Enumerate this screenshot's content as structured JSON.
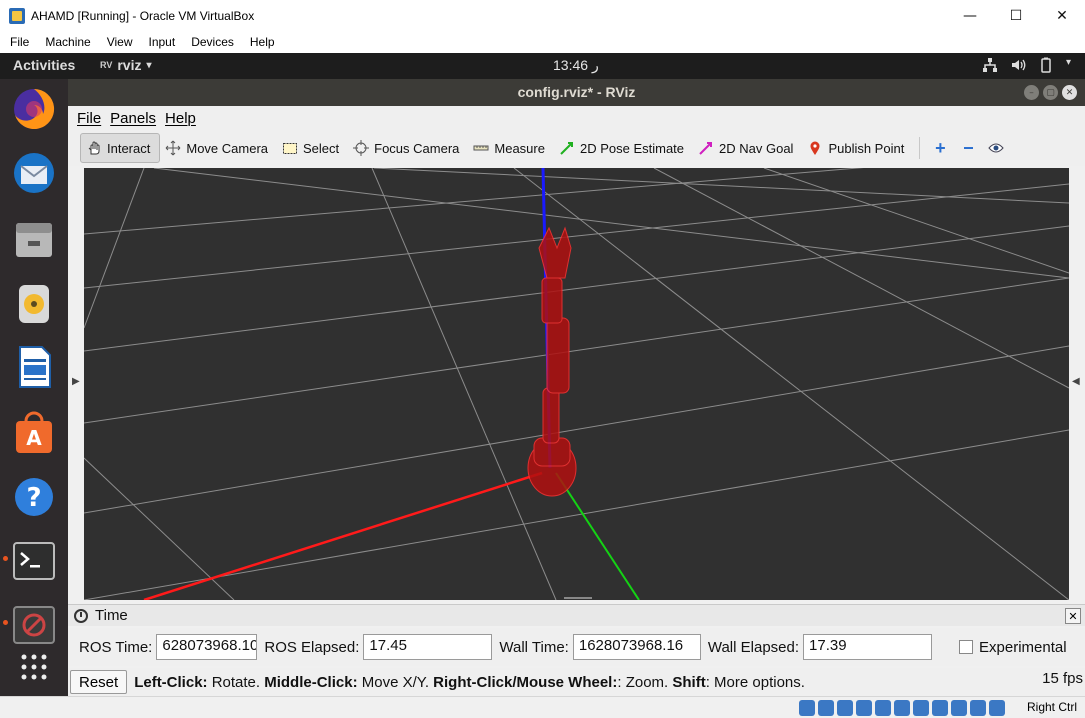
{
  "host_window": {
    "title": "AHAMD [Running] - Oracle VM VirtualBox",
    "menu": [
      "File",
      "Machine",
      "View",
      "Input",
      "Devices",
      "Help"
    ],
    "controls": [
      "—",
      "☐",
      "✕"
    ],
    "status_key": "Right Ctrl"
  },
  "gnome": {
    "activities": "Activities",
    "app_name": "rviz",
    "app_icon_text": "RV",
    "clock": "13:46 ر"
  },
  "dock": {
    "items": [
      "firefox",
      "thunderbird",
      "files",
      "rhythmbox",
      "libreoffice-writer",
      "software-center",
      "help",
      "terminal",
      "ros-app",
      "show-applications"
    ]
  },
  "rviz": {
    "window_title": "config.rviz* - RViz",
    "menu": [
      "File",
      "Panels",
      "Help"
    ],
    "tools": [
      {
        "label": "Interact",
        "icon": "hand-icon"
      },
      {
        "label": "Move Camera",
        "icon": "move-camera-icon"
      },
      {
        "label": "Select",
        "icon": "select-icon"
      },
      {
        "label": "Focus Camera",
        "icon": "focus-camera-icon"
      },
      {
        "label": "Measure",
        "icon": "ruler-icon"
      },
      {
        "label": "2D Pose Estimate",
        "icon": "green-arrow-icon"
      },
      {
        "label": "2D Nav Goal",
        "icon": "magenta-arrow-icon"
      },
      {
        "label": "Publish Point",
        "icon": "map-pin-icon"
      }
    ],
    "active_tool": "Interact",
    "colors": {
      "viewport_bg": "#303030",
      "grid": "#8c8c8c",
      "axis_x": "#ff0000",
      "axis_y": "#00ff00",
      "axis_z": "#0000ff",
      "robot": "#c81010"
    }
  },
  "time_panel": {
    "title": "Time",
    "ros_time_label": "ROS Time:",
    "ros_time_value": "628073968.10",
    "ros_elapsed_label": "ROS Elapsed:",
    "ros_elapsed_value": "17.45",
    "wall_time_label": "Wall Time:",
    "wall_time_value": "1628073968.16",
    "wall_elapsed_label": "Wall Elapsed:",
    "wall_elapsed_value": "17.39",
    "experimental_label": "Experimental"
  },
  "status": {
    "reset_label": "Reset",
    "left_click_label": "Left-Click:",
    "left_click_text": " Rotate. ",
    "middle_click_label": "Middle-Click:",
    "middle_click_text": " Move X/Y. ",
    "right_click_label": "Right-Click/Mouse Wheel:",
    "right_click_text": ": Zoom. ",
    "shift_label": "Shift",
    "shift_text": ": More options.",
    "fps": "15 fps"
  }
}
